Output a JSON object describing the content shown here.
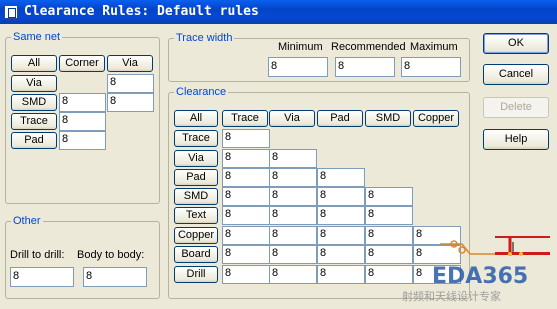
{
  "window": {
    "title": "Clearance Rules: Default rules"
  },
  "same_net": {
    "legend": "Same net",
    "col_headers": [
      "All",
      "Corner",
      "Via"
    ],
    "row_headers": [
      "Via",
      "SMD",
      "Trace",
      "Pad"
    ],
    "values": {
      "via_via": "8",
      "smd_corner": "8",
      "smd_via": "8",
      "trace_corner": "8",
      "pad_corner": "8"
    }
  },
  "other": {
    "legend": "Other",
    "drill_to_drill_label": "Drill to drill:",
    "body_to_body_label": "Body to body:",
    "drill_to_drill_value": "8",
    "body_to_body_value": "8"
  },
  "trace_width": {
    "legend": "Trace width",
    "minimum_label": "Minimum",
    "recommended_label": "Recommended",
    "maximum_label": "Maximum",
    "minimum_value": "8",
    "recommended_value": "8",
    "maximum_value": "8"
  },
  "clearance": {
    "legend": "Clearance",
    "all_label": "All",
    "col_headers": [
      "Trace",
      "Via",
      "Pad",
      "SMD",
      "Copper"
    ],
    "row_headers": [
      "Trace",
      "Via",
      "Pad",
      "SMD",
      "Text",
      "Copper",
      "Board",
      "Drill"
    ],
    "rows": [
      [
        "8"
      ],
      [
        "8",
        "8"
      ],
      [
        "8",
        "8",
        "8"
      ],
      [
        "8",
        "8",
        "8",
        "8"
      ],
      [
        "8",
        "8",
        "8",
        "8"
      ],
      [
        "8",
        "8",
        "8",
        "8",
        "8"
      ],
      [
        "8",
        "8",
        "8",
        "8",
        "8"
      ],
      [
        "8",
        "8",
        "8",
        "8",
        "8"
      ]
    ]
  },
  "buttons": {
    "ok": "OK",
    "cancel": "Cancel",
    "delete": "Delete",
    "help": "Help"
  },
  "watermark": {
    "brand": "EDA365",
    "subtitle": "射频和天线设计专家"
  }
}
